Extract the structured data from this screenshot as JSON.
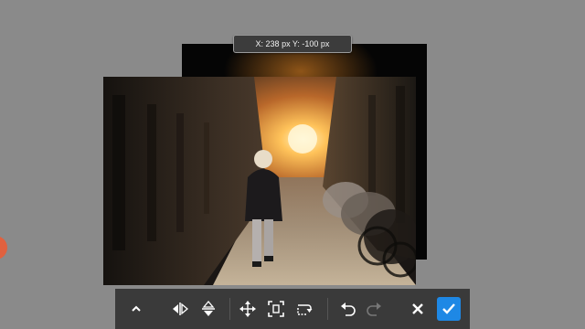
{
  "readout": {
    "text": "X: 238 px Y: -100 px"
  },
  "toolbar": {
    "buttons": [
      {
        "name": "collapse-button",
        "icon": "chevron-up-icon"
      },
      {
        "name": "flip-horizontal-button",
        "icon": "flip-horizontal-icon"
      },
      {
        "name": "flip-vertical-button",
        "icon": "flip-vertical-icon"
      },
      {
        "name": "move-button",
        "icon": "move-arrows-icon"
      },
      {
        "name": "fit-to-screen-button",
        "icon": "fit-frame-icon"
      },
      {
        "name": "rotate-button",
        "icon": "rotate-icon"
      },
      {
        "name": "undo-button",
        "icon": "undo-icon"
      },
      {
        "name": "redo-button",
        "icon": "redo-icon"
      },
      {
        "name": "cancel-button",
        "icon": "close-icon"
      },
      {
        "name": "apply-button",
        "icon": "check-icon"
      }
    ],
    "colors": {
      "background": "#3a3a3a",
      "accent": "#1e88e5",
      "icon": "#ffffff",
      "icon_disabled": "#777777"
    }
  },
  "image": {
    "description_icon": "photo-person-walking-alley"
  },
  "colors": {
    "workspace": "#8a8a8a",
    "handle": "#e0613f"
  }
}
